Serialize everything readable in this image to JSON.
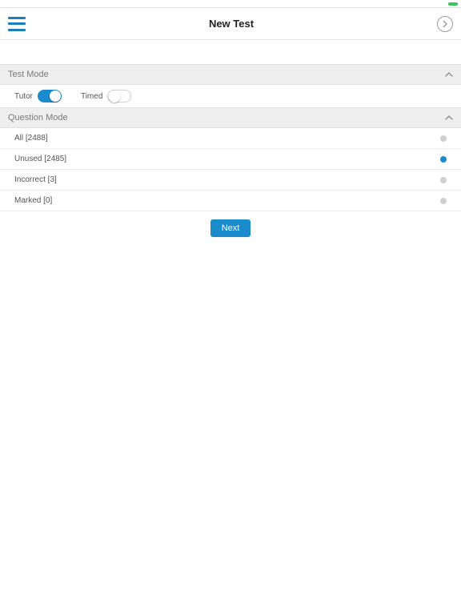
{
  "header": {
    "title": "New Test"
  },
  "sections": {
    "test_mode": {
      "header": "Test Mode",
      "tutor_label": "Tutor",
      "tutor_on": true,
      "timed_label": "Timed",
      "timed_on": false
    },
    "question_mode": {
      "header": "Question Mode",
      "options": [
        {
          "label": "All [2488]",
          "selected": false
        },
        {
          "label": "Unused [2485]",
          "selected": true
        },
        {
          "label": "Incorrect [3]",
          "selected": false
        },
        {
          "label": "Marked [0]",
          "selected": false
        }
      ]
    }
  },
  "actions": {
    "next_label": "Next"
  },
  "colors": {
    "accent": "#1a8ccb"
  }
}
